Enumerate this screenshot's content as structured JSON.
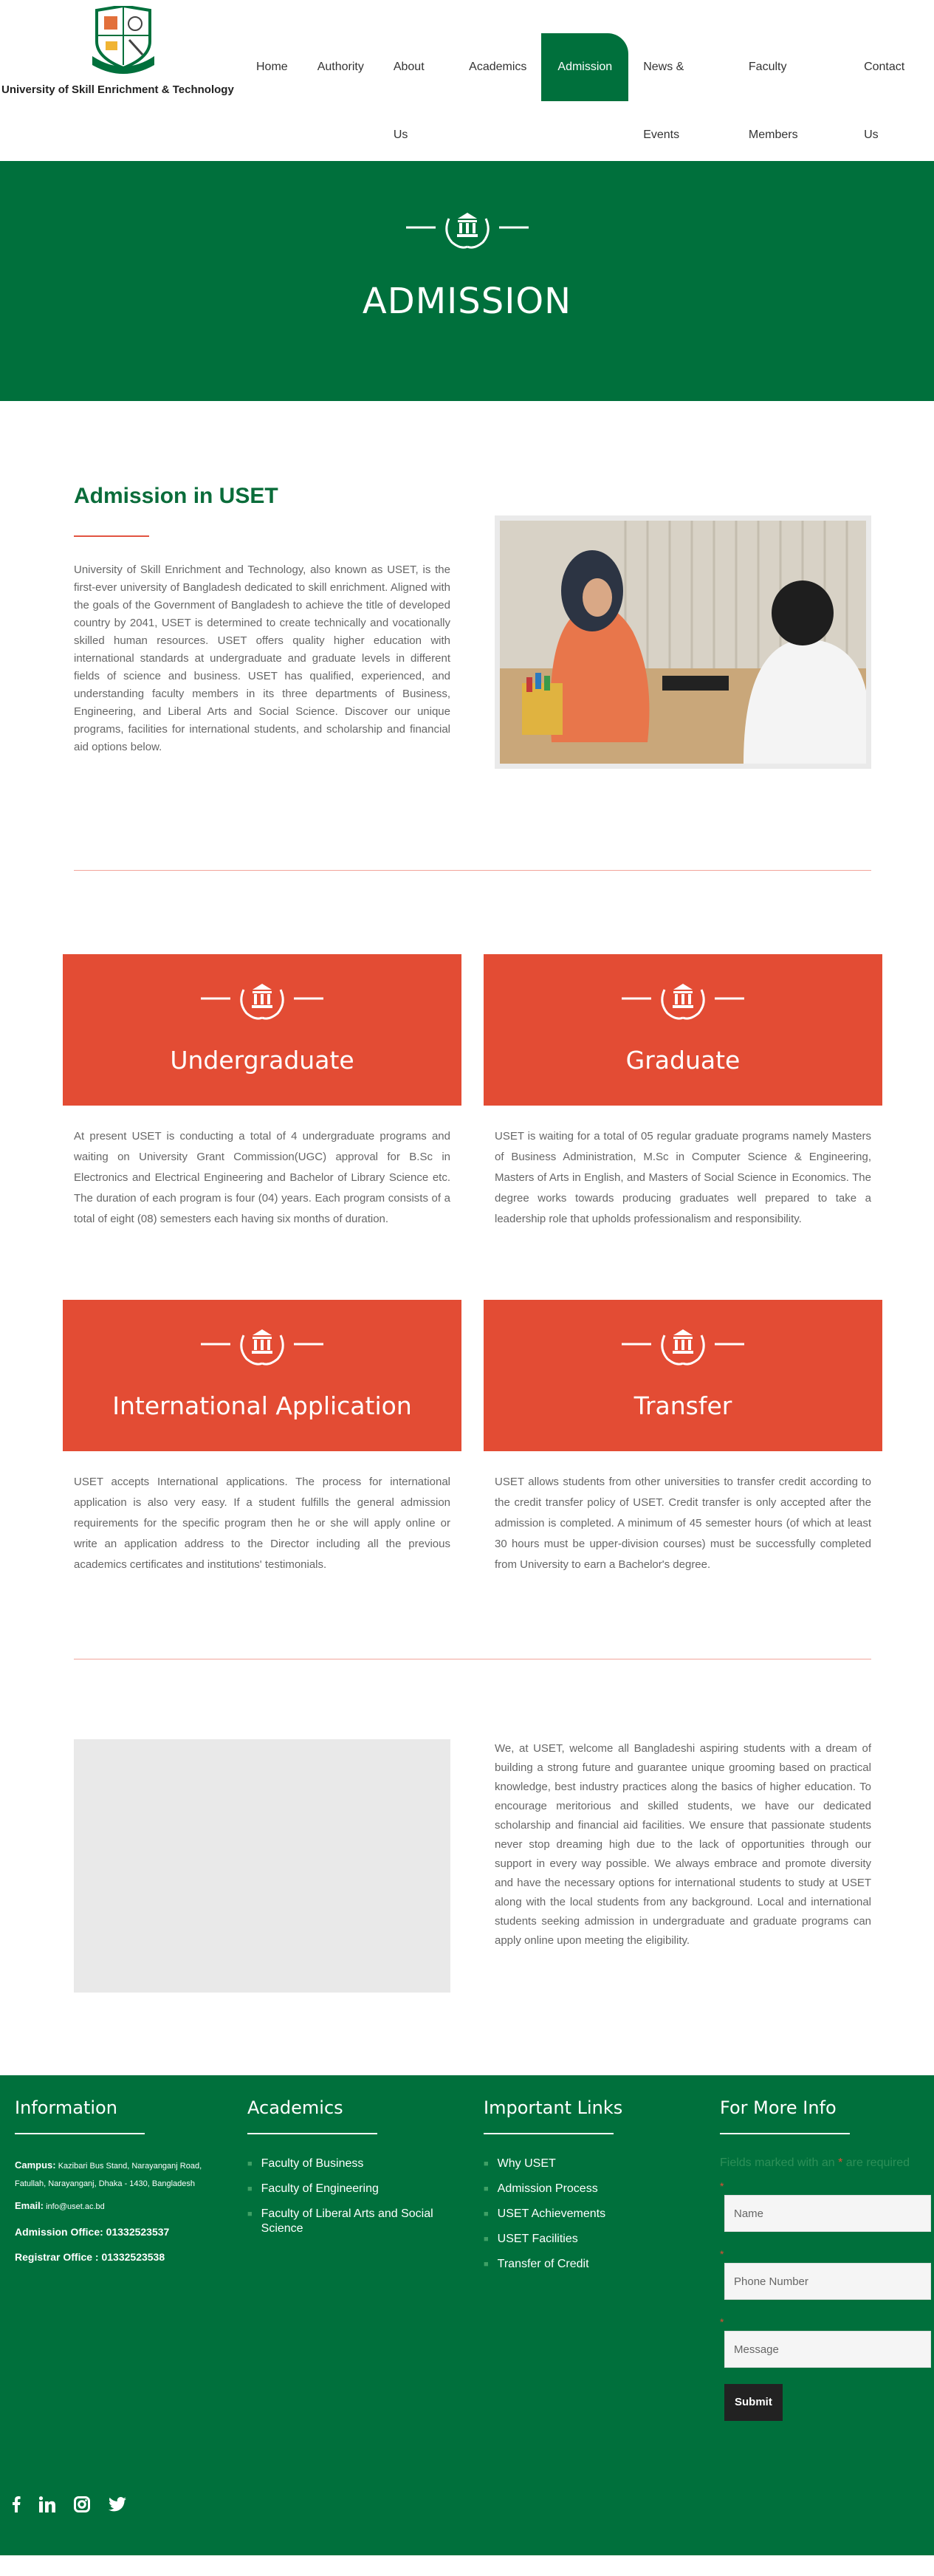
{
  "header": {
    "brand": "University of Skill Enrichment & Technology",
    "nav": [
      "Home",
      "Authority",
      "About Us",
      "Academics",
      "Admission",
      "News & Events",
      "Faculty Members",
      "Contact Us"
    ],
    "active_nav": "Admission"
  },
  "banner": {
    "title": "ADMISSION"
  },
  "about": {
    "title": "Admission in USET",
    "text": "University of Skill Enrichment and Technology, also known as USET, is the first-ever university of Bangladesh dedicated to skill enrichment. Aligned with the goals of the Government of Bangladesh to achieve the title of developed country by 2041, USET is determined to create technically and vocationally skilled human resources. USET offers quality higher education with international standards at undergraduate and graduate levels in different fields of science and business. USET has qualified, experienced, and understanding faculty members in its three departments of Business, Engineering, and Liberal Arts and Social Science. Discover our unique programs, facilities for international students, and scholarship and financial aid options below."
  },
  "programs": [
    {
      "title": "Undergraduate",
      "text": "At present USET is conducting a total of 4 undergraduate programs and waiting on University Grant Commission(UGC) approval for B.Sc in Electronics and Electrical Engineering and Bachelor of Library Science etc. The duration of each program is four (04) years. Each program consists of a total of eight (08) semesters each having six months of duration."
    },
    {
      "title": "Graduate",
      "text": "USET is waiting for a total of 05 regular graduate programs namely Masters of Business Administration, M.Sc in Computer Science & Engineering, Masters of Arts in English, and Masters of Social Science in Economics. The degree works towards producing graduates well prepared to take a leadership role that upholds professionalism and responsibility."
    },
    {
      "title": "International Application",
      "text": "USET accepts International applications. The process for international application is also very easy. If a student fulfills the general admission requirements for the specific program then he or she will apply online or write an application address to the Director including all the previous academics certificates and institutions' testimonials."
    },
    {
      "title": "Transfer",
      "text": "USET allows students from other universities to transfer credit according to the credit transfer policy of USET. Credit transfer is only accepted after the admission is completed. A minimum of 45 semester hours (of which at least 30 hours must be upper-division courses) must be successfully completed from University to earn a Bachelor's degree."
    }
  ],
  "welcome": {
    "text": "We, at USET, welcome all Bangladeshi aspiring students with a dream of building a strong future and guarantee unique grooming based on practical knowledge, best industry practices along the basics of higher education. To encourage meritorious and skilled students, we have our dedicated scholarship and financial aid facilities. We ensure that passionate students never stop dreaming high due to the lack of opportunities through our support in every way possible. We always embrace and promote diversity and have the necessary options for international students to study at USET along with the local students from any background. Local and international students seeking admission in undergraduate and graduate programs can apply online upon meeting the eligibility."
  },
  "footer": {
    "information": {
      "heading": "Information",
      "campus_label": "Campus:",
      "campus": "Kazibari Bus Stand, Narayanganj Road, Fatullah, Narayanganj, Dhaka - 1430, Bangladesh",
      "email_label": "Email:",
      "email": "info@uset.ac.bd",
      "admission_office": "Admission Office: 01332523537",
      "registrar_office": "Registrar Office : 01332523538"
    },
    "academics": {
      "heading": "Academics",
      "items": [
        "Faculty of Business",
        "Faculty of Engineering",
        "Faculty of Liberal Arts and Social Science"
      ]
    },
    "links": {
      "heading": "Important Links",
      "items": [
        "Why USET",
        "Admission Process",
        "USET Achievements",
        "USET Facilities",
        "Transfer of Credit"
      ]
    },
    "contact": {
      "heading": "For More Info",
      "note": "Fields marked with an",
      "note_tail": "are required",
      "required_mark": "*",
      "name_placeholder": "Name",
      "phone_placeholder": "Phone Number",
      "message_placeholder": "Message",
      "submit": "Submit"
    },
    "social": [
      "facebook-icon",
      "linkedin-icon",
      "instagram-icon",
      "twitter-icon"
    ]
  },
  "colors": {
    "green": "#00703c",
    "red": "#e34c34",
    "gold": "#c8a33e"
  }
}
